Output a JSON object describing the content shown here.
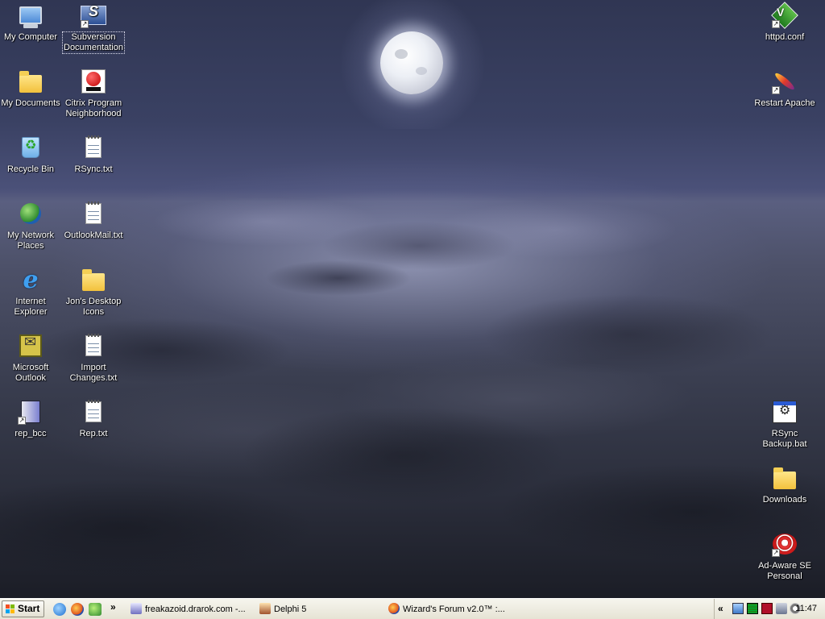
{
  "desktop": {
    "icons_left": [
      {
        "label": "My Computer",
        "icon": "computer-icon"
      },
      {
        "label": "My Documents",
        "icon": "documents-folder-icon"
      },
      {
        "label": "Recycle Bin",
        "icon": "recycle-bin-icon"
      },
      {
        "label": "My Network Places",
        "icon": "network-places-icon"
      },
      {
        "label": "Internet Explorer",
        "icon": "internet-explorer-icon"
      },
      {
        "label": "Microsoft Outlook",
        "icon": "outlook-icon"
      },
      {
        "label": "rep_bcc",
        "icon": "rep-bcc-icon"
      }
    ],
    "icons_left2": [
      {
        "label": "Subversion Documentation",
        "icon": "subversion-icon",
        "selected": true
      },
      {
        "label": "Citrix Program Neighborhood",
        "icon": "citrix-icon"
      },
      {
        "label": "RSync.txt",
        "icon": "text-file-icon"
      },
      {
        "label": "OutlookMail.txt",
        "icon": "text-file-icon"
      },
      {
        "label": "Jon's Desktop Icons",
        "icon": "folder-icon"
      },
      {
        "label": "Import Changes.txt",
        "icon": "text-file-icon"
      },
      {
        "label": "Rep.txt",
        "icon": "text-file-icon"
      }
    ],
    "icons_right": [
      {
        "label": "httpd.conf",
        "icon": "vim-icon"
      },
      {
        "label": "Restart Apache",
        "icon": "apache-feather-icon"
      },
      {
        "label": "RSync Backup.bat",
        "icon": "batch-file-icon"
      },
      {
        "label": "Downloads",
        "icon": "folder-icon"
      },
      {
        "label": "Ad-Aware SE Personal",
        "icon": "ad-aware-icon"
      }
    ]
  },
  "taskbar": {
    "start_label": "Start",
    "quick_launch_more": "»",
    "tasks": [
      {
        "label": "freakazoid.drarok.com -..."
      },
      {
        "label": "Delphi 5"
      },
      {
        "label": "Wizard's Forum v2.0™ :..."
      }
    ],
    "tray_expand": "«",
    "clock": "11:47"
  }
}
